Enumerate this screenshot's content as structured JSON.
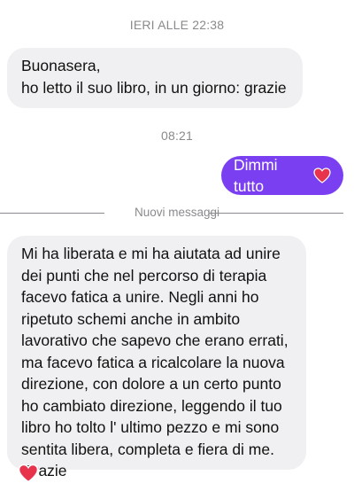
{
  "thread": {
    "timestamp_1": "IERI ALLE 22:38",
    "incoming_1": {
      "lines": [
        "Buonasera,",
        "ho letto il suo libro, in un giorno: grazie"
      ]
    },
    "timestamp_2": "08:21",
    "outgoing_1": {
      "text": "Dimmi tutto",
      "emoji": "heart-emoji"
    },
    "new_messages_label": "Nuovi messaggi",
    "incoming_2": {
      "lines": [
        "Mi ha liberata e mi ha aiutata ad unire",
        "dei punti che nel percorso di terapia",
        "facevo fatica a unire. Negli anni ho",
        "ripetuto schemi anche in ambito",
        "lavorativo che sapevo che erano errati,",
        "ma facevo fatica a ricalcolare la nuova",
        "direzione, con dolore a un certo punto",
        "ho cambiato direzione, leggendo il tuo",
        "libro ho tolto l' ultimo pezzo e mi sono",
        "sentita libera, completa e fiera di me.",
        "Grazie"
      ],
      "reaction": "heart-emoji"
    }
  },
  "colors": {
    "outgoing_bubble": "#7b3ff2",
    "incoming_bubble": "#f0f0f2",
    "heart": "#e8334d",
    "meta_text": "#8a8a8e"
  }
}
